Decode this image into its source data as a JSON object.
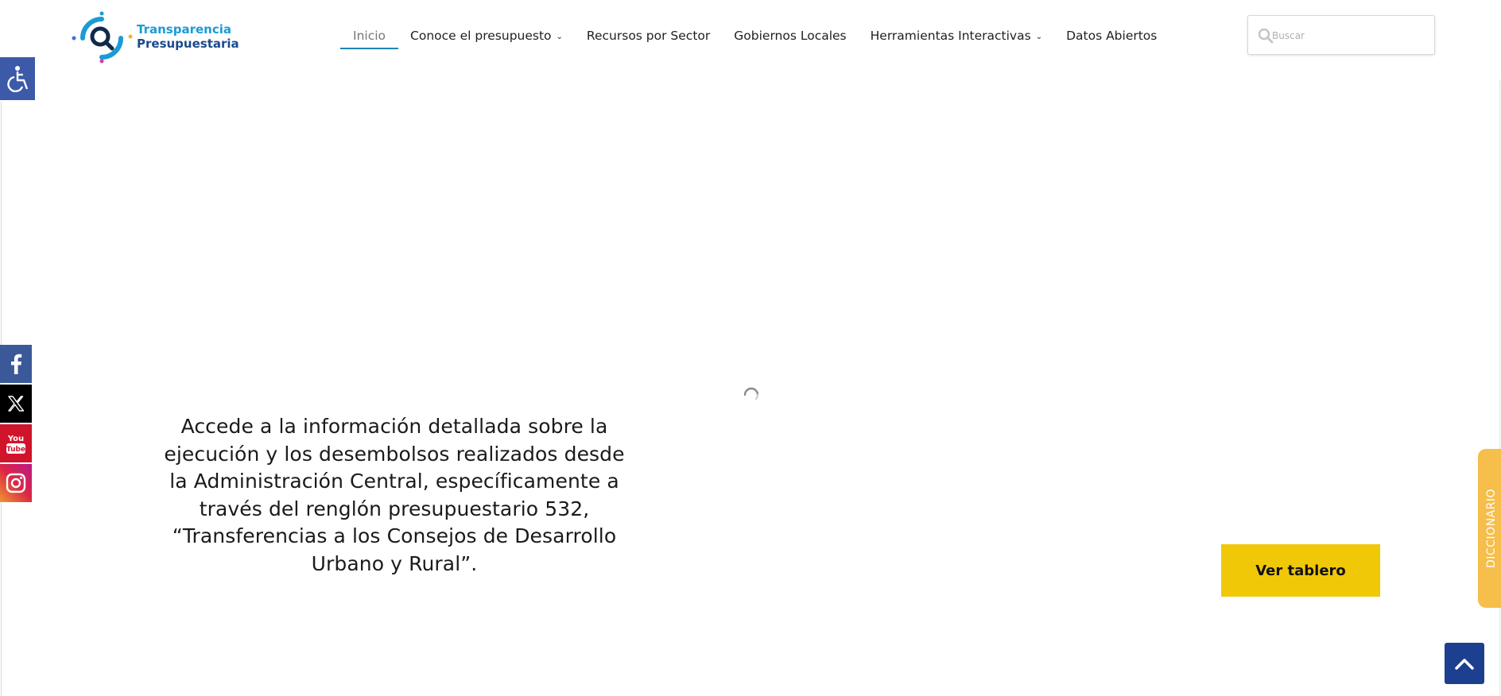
{
  "header": {
    "logo_line1": "Transparencia",
    "logo_line2": "Presupuestaria",
    "nav": [
      {
        "label": "Inicio",
        "active": true,
        "has_dropdown": false
      },
      {
        "label": "Conoce el presupuesto",
        "active": false,
        "has_dropdown": true
      },
      {
        "label": "Recursos por Sector",
        "active": false,
        "has_dropdown": false
      },
      {
        "label": "Gobiernos Locales",
        "active": false,
        "has_dropdown": false
      },
      {
        "label": "Herramientas Interactivas",
        "active": false,
        "has_dropdown": true
      },
      {
        "label": "Datos Abiertos",
        "active": false,
        "has_dropdown": false
      }
    ],
    "search": {
      "placeholder": "Buscar",
      "icon": "search-icon"
    }
  },
  "accessibility": {
    "icon": "wheelchair-icon",
    "color": "#3c5aa8"
  },
  "social": [
    {
      "name": "facebook",
      "icon": "facebook-icon",
      "color": "#3b5998"
    },
    {
      "name": "x",
      "icon": "x-icon",
      "color": "#000000"
    },
    {
      "name": "youtube",
      "icon": "youtube-icon",
      "color": "#d0142b"
    },
    {
      "name": "instagram",
      "icon": "instagram-icon",
      "color": "#dc2743"
    }
  ],
  "main": {
    "intro_text": "Accede a la información detallada sobre la ejecución y los desembolsos realizados desde la Administración Central, específicamente a través del renglón presupuestario 532, “Transferencias a los Consejos de Desarrollo Urbano y Rural”.",
    "cta_label": "Ver tablero",
    "cta_color": "#f0c808",
    "loader_icon": "loading-spinner-icon"
  },
  "dictionary_tab": {
    "label": "DICCIONARIO",
    "color": "#f6be4a"
  },
  "back_to_top": {
    "icon": "chevron-up-icon",
    "color": "#1c3f8f"
  }
}
